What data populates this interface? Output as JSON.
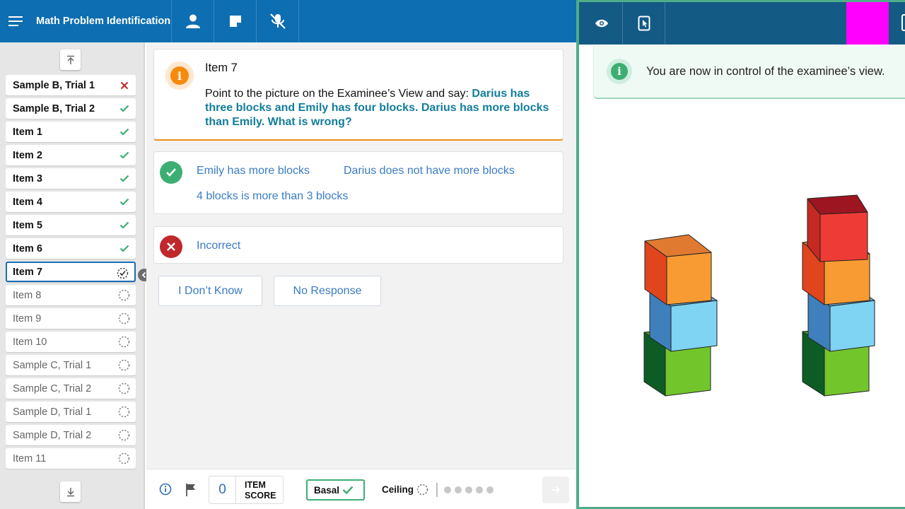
{
  "app": {
    "title": "Math Problem Identification"
  },
  "toolbar": {
    "buttons": [
      "menu-icon",
      "person-icon",
      "note-icon",
      "mic-off-icon"
    ]
  },
  "examinee_view": {
    "toolbar_icons": [
      "eye-icon",
      "tablet-pointer-icon"
    ],
    "highlight_color": "#ff00ff",
    "banner_text": "You are now in control of the examinee’s view."
  },
  "sidebar": {
    "items": [
      {
        "label": "Sample B, Trial 1",
        "status": "incorrect"
      },
      {
        "label": "Sample B, Trial 2",
        "status": "correct"
      },
      {
        "label": "Item 1",
        "status": "correct"
      },
      {
        "label": "Item 2",
        "status": "correct"
      },
      {
        "label": "Item 3",
        "status": "correct"
      },
      {
        "label": "Item 4",
        "status": "correct"
      },
      {
        "label": "Item 5",
        "status": "correct"
      },
      {
        "label": "Item 6",
        "status": "correct"
      },
      {
        "label": "Item 7",
        "status": "current"
      },
      {
        "label": "Item 8",
        "status": "pending"
      },
      {
        "label": "Item 9",
        "status": "pending"
      },
      {
        "label": "Item 10",
        "status": "pending"
      },
      {
        "label": "Sample C, Trial 1",
        "status": "pending"
      },
      {
        "label": "Sample C, Trial 2",
        "status": "pending"
      },
      {
        "label": "Sample D, Trial 1",
        "status": "pending"
      },
      {
        "label": "Sample D, Trial 2",
        "status": "pending"
      },
      {
        "label": "Item 11",
        "status": "pending"
      }
    ]
  },
  "prompt": {
    "title": "Item 7",
    "instruction": "Point to the picture on the Examinee’s View and say: ",
    "quote": "Darius has three blocks and Emily has four blocks. Darius has more blocks than Emily. What is wrong?"
  },
  "correct_responses": [
    "Emily has more blocks",
    "Darius does not have more blocks",
    "4 blocks is more than 3 blocks"
  ],
  "incorrect_response": "Incorrect",
  "options": {
    "dont_know": "I Don’t Know",
    "no_response": "No Response"
  },
  "footer": {
    "item_score_value": "0",
    "item_score_label": "ITEM\nSCORE",
    "basal_label": "Basal",
    "ceiling_label": "Ceiling",
    "ceiling_dots": 5
  },
  "colors": {
    "primary": "#0d6eb1",
    "correct": "#3dae73",
    "incorrect": "#c0282b",
    "prompt_accent": "#f08b1d",
    "link": "#3a7cc4"
  }
}
